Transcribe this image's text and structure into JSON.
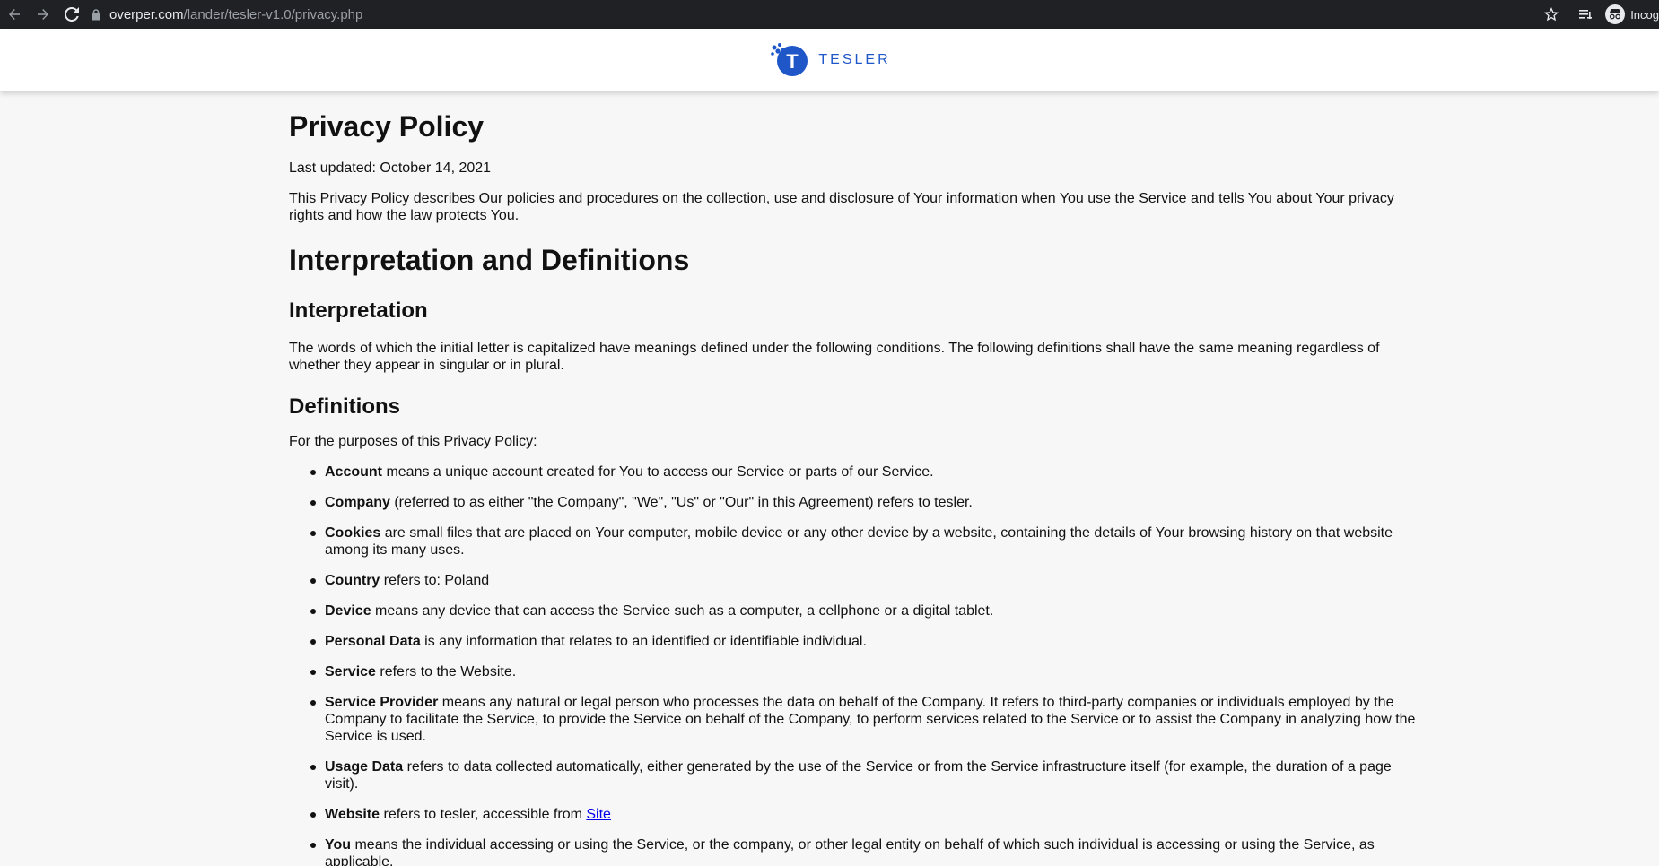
{
  "browser": {
    "url_domain": "overper.com",
    "url_path": "/lander/tesler-v1.0/privacy.php",
    "profile_label": "Incog"
  },
  "site": {
    "brand": "TESLER",
    "logo_letter": "T",
    "brand_color": "#1f57c9"
  },
  "page": {
    "title": "Privacy Policy",
    "last_updated": "Last updated: October 14, 2021",
    "intro": "This Privacy Policy describes Our policies and procedures on the collection, use and disclosure of Your information when You use the Service and tells You about Your privacy rights and how the law protects You.",
    "section_interp_defs": "Interpretation and Definitions",
    "interpretation_heading": "Interpretation",
    "interpretation_text": "The words of which the initial letter is capitalized have meanings defined under the following conditions. The following definitions shall have the same meaning regardless of whether they appear in singular or in plural.",
    "definitions_heading": "Definitions",
    "definitions_intro": "For the purposes of this Privacy Policy:",
    "definitions": [
      {
        "term": "Account",
        "text": " means a unique account created for You to access our Service or parts of our Service."
      },
      {
        "term": "Company",
        "text": " (referred to as either \"the Company\", \"We\", \"Us\" or \"Our\" in this Agreement) refers to tesler."
      },
      {
        "term": "Cookies",
        "text": " are small files that are placed on Your computer, mobile device or any other device by a website, containing the details of Your browsing history on that website among its many uses."
      },
      {
        "term": "Country",
        "text": " refers to: Poland"
      },
      {
        "term": "Device",
        "text": " means any device that can access the Service such as a computer, a cellphone or a digital tablet."
      },
      {
        "term": "Personal Data",
        "text": " is any information that relates to an identified or identifiable individual."
      },
      {
        "term": "Service",
        "text": " refers to the Website."
      },
      {
        "term": "Service Provider",
        "text": " means any natural or legal person who processes the data on behalf of the Company. It refers to third-party companies or individuals employed by the Company to facilitate the Service, to provide the Service on behalf of the Company, to perform services related to the Service or to assist the Company in analyzing how the Service is used."
      },
      {
        "term": "Usage Data",
        "text": " refers to data collected automatically, either generated by the use of the Service or from the Service infrastructure itself (for example, the duration of a page visit)."
      },
      {
        "term": "Website",
        "text": " refers to tesler, accessible from ",
        "link": "Site"
      },
      {
        "term": "You",
        "text": " means the individual accessing or using the Service, or the company, or other legal entity on behalf of which such individual is accessing or using the Service, as applicable."
      }
    ]
  }
}
